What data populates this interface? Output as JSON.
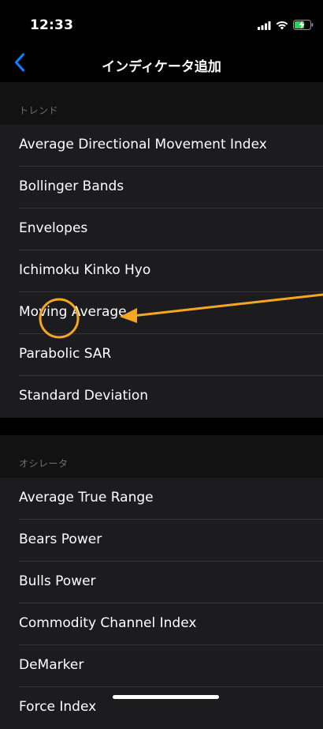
{
  "status_bar": {
    "time": "12:33",
    "icons": [
      "signal-icon",
      "wifi-icon",
      "battery-charging-icon"
    ]
  },
  "nav": {
    "back_icon": "chevron-left-icon",
    "title": "インディケータ追加"
  },
  "sections": [
    {
      "header": "トレンド",
      "items": [
        "Average Directional Movement Index",
        "Bollinger Bands",
        "Envelopes",
        "Ichimoku Kinko Hyo",
        "Moving Average",
        "Parabolic SAR",
        "Standard Deviation"
      ]
    },
    {
      "header": "オシレータ",
      "items": [
        "Average True Range",
        "Bears Power",
        "Bulls Power",
        "Commodity Channel Index",
        "DeMarker",
        "Force Index"
      ]
    }
  ],
  "colors": {
    "accent": "#0a84ff",
    "annotation": "#f5a623",
    "background": "#000000",
    "row": "#1c1c1e",
    "section_header": "#121212"
  }
}
